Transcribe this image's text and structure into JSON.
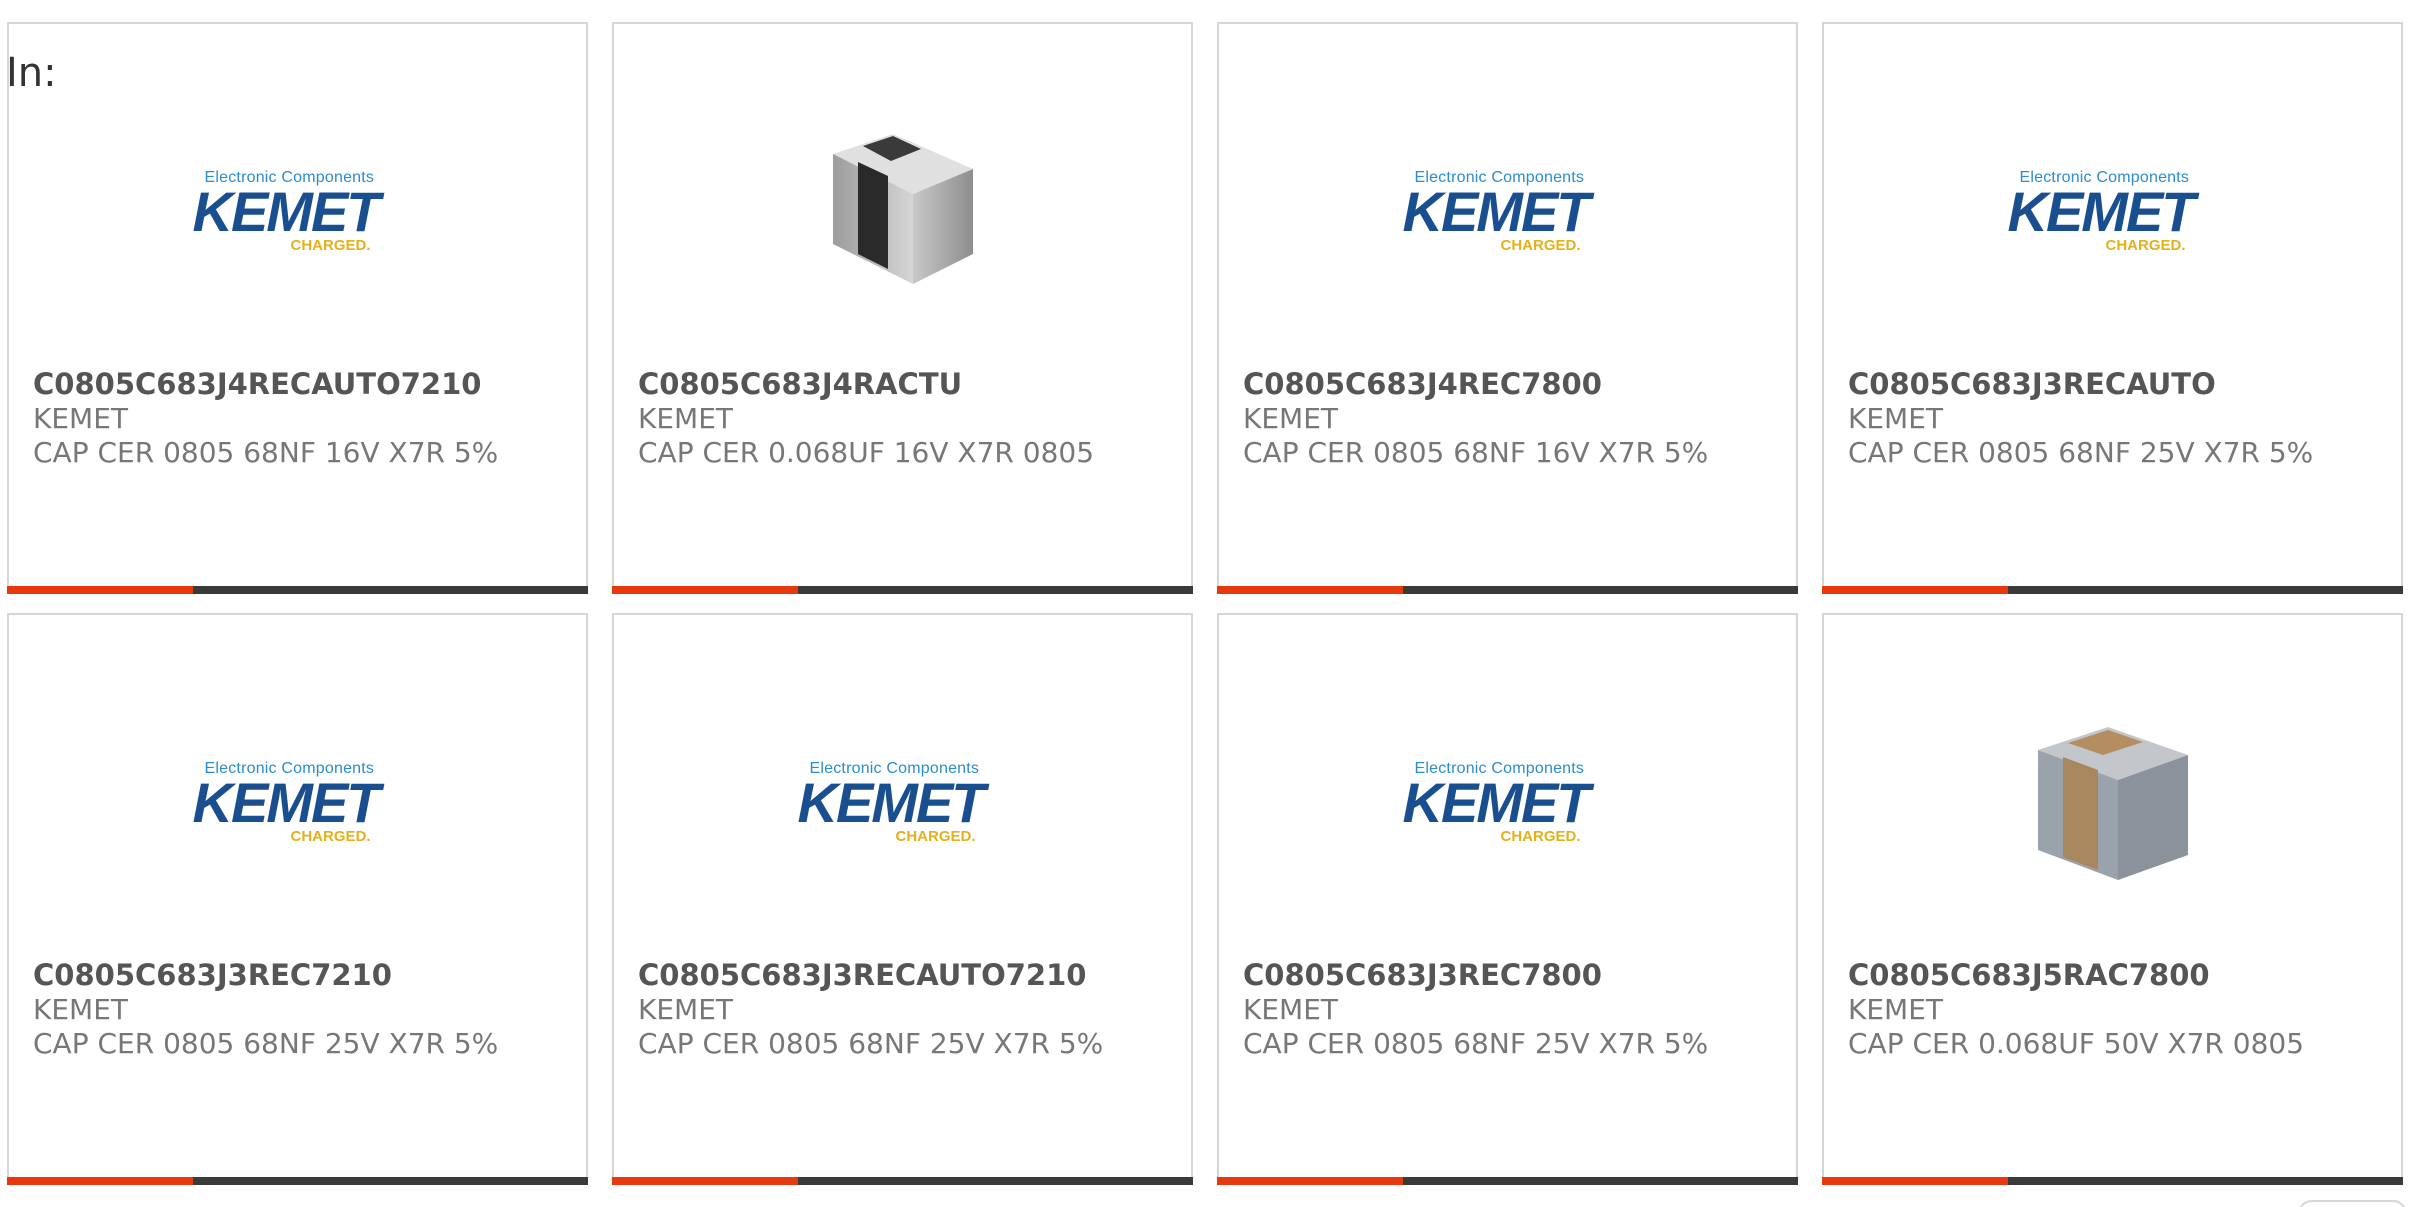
{
  "in_label": "In:",
  "logo": {
    "tagline": "Electronic Components",
    "wordmark": "KEMET",
    "sub": "CHARGED."
  },
  "colors": {
    "accent_bar": "#e8380d",
    "bar_track": "#3a3a3a",
    "card_border": "#d6d6d6"
  },
  "products": [
    {
      "part_number": "C0805C683J4RECAUTO7210",
      "manufacturer": "KEMET",
      "description": "CAP CER 0805 68NF 16V X7R 5%",
      "image": "kemet-logo",
      "progress": 0.32
    },
    {
      "part_number": "C0805C683J4RACTU",
      "manufacturer": "KEMET",
      "description": "CAP CER 0.068UF 16V X7R 0805",
      "image": "black-chip-capacitor",
      "progress": 0.32
    },
    {
      "part_number": "C0805C683J4REC7800",
      "manufacturer": "KEMET",
      "description": "CAP CER 0805 68NF 16V X7R 5%",
      "image": "kemet-logo",
      "progress": 0.32
    },
    {
      "part_number": "C0805C683J3RECAUTO",
      "manufacturer": "KEMET",
      "description": "CAP CER 0805 68NF 25V X7R 5%",
      "image": "kemet-logo",
      "progress": 0.32
    },
    {
      "part_number": "C0805C683J3REC7210",
      "manufacturer": "KEMET",
      "description": "CAP CER 0805 68NF 25V X7R 5%",
      "image": "kemet-logo",
      "progress": 0.32
    },
    {
      "part_number": "C0805C683J3RECAUTO7210",
      "manufacturer": "KEMET",
      "description": "CAP CER 0805 68NF 25V X7R 5%",
      "image": "kemet-logo",
      "progress": 0.32
    },
    {
      "part_number": "C0805C683J3REC7800",
      "manufacturer": "KEMET",
      "description": "CAP CER 0805 68NF 25V X7R 5%",
      "image": "kemet-logo",
      "progress": 0.32
    },
    {
      "part_number": "C0805C683J5RAC7800",
      "manufacturer": "KEMET",
      "description": "CAP CER 0.068UF 50V X7R 0805",
      "image": "tan-chip-capacitor",
      "progress": 0.32
    }
  ]
}
